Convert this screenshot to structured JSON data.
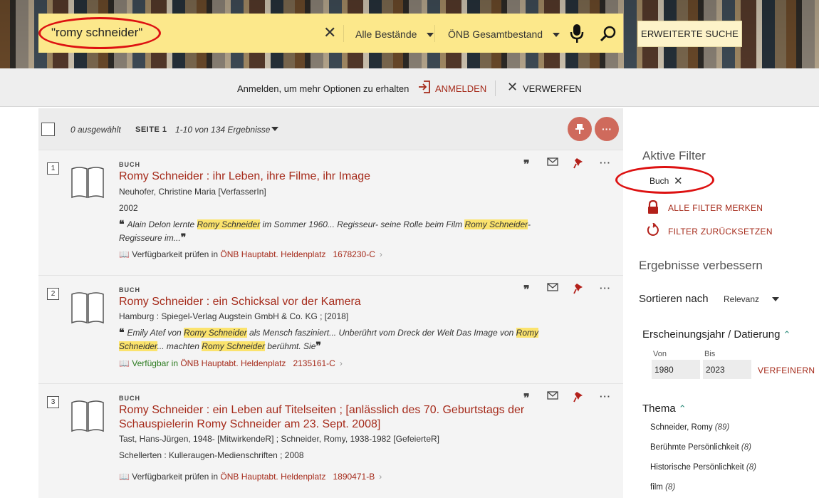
{
  "search": {
    "query": "\"romy schneider\"",
    "scope": "Alle Bestände",
    "collection": "ÖNB Gesamtbestand",
    "advanced_label": "ERWEITERTE SUCHE"
  },
  "login_bar": {
    "text": "Anmelden, um mehr Optionen zu erhalten",
    "login_label": "ANMELDEN",
    "dismiss_label": "VERWERFEN"
  },
  "results_header": {
    "selected": "0 ausgewählt",
    "page": "SEITE 1",
    "count": "1-10 von 134 Ergebnisse"
  },
  "results": [
    {
      "num": "1",
      "type": "BUCH",
      "title": "Romy Schneider : ihr Leben, ihre Filme, ihr Image",
      "author": "Neuhofer, Christine Maria [VerfasserIn]",
      "year": "2002",
      "snippet_parts": [
        "Alain Delon lernte ",
        "Romy Schneider",
        " im Sommer 1960... Regisseur- seine Rolle beim Film ",
        "Romy Schneider",
        "-Regisseure im..."
      ],
      "avail_status": "Verfügbarkeit prüfen in",
      "avail_location": "ÖNB Hauptabt. Heldenplatz",
      "shelfmark": "1678230-C"
    },
    {
      "num": "2",
      "type": "BUCH",
      "title": "Romy Schneider : ein Schicksal vor der Kamera",
      "author": "Hamburg : Spiegel-Verlag Augstein GmbH & Co. KG ; [2018]",
      "snippet_parts": [
        "Emily Atef von ",
        "Romy Schneider",
        " als Mensch fasziniert... Unberührt vom Dreck der Welt Das Image von ",
        "Romy Schneider",
        "... machten ",
        "Romy Schneider",
        " berühmt. Sie"
      ],
      "avail_status": "Verfügbar in",
      "avail_location": "ÖNB Hauptabt. Heldenplatz",
      "shelfmark": "2135161-C"
    },
    {
      "num": "3",
      "type": "BUCH",
      "title": "Romy Schneider : ein Leben auf Titelseiten ; [anlässlich des 70. Geburtstags der Schauspielerin Romy Schneider am 23. Sept. 2008]",
      "author": "Tast, Hans-Jürgen, 1948- [MitwirkendeR] ; Schneider, Romy, 1938-1982 [GefeierteR]",
      "publisher": "Schellerten : Kulleraugen-Medienschriften ; 2008",
      "avail_status": "Verfügbarkeit prüfen in",
      "avail_location": "ÖNB Hauptabt. Heldenplatz",
      "shelfmark": "1890471-B"
    }
  ],
  "sidebar": {
    "active_filters_title": "Aktive Filter",
    "active_filter": "Buch",
    "remember_filters": "ALLE FILTER MERKEN",
    "reset_filters": "FILTER ZURÜCKSETZEN",
    "improve_title": "Ergebnisse verbessern",
    "sort_label": "Sortieren nach",
    "sort_value": "Relevanz",
    "year_facet": "Erscheinungsjahr / Datierung",
    "from_label": "Von",
    "to_label": "Bis",
    "from_value": "1980",
    "to_value": "2023",
    "refine_label": "VERFEINERN",
    "topic_facet": "Thema",
    "topics": [
      {
        "name": "Schneider, Romy",
        "count": "(89)"
      },
      {
        "name": "Berühmte Persönlichkeit",
        "count": "(8)"
      },
      {
        "name": "Historische Persönlichkeit",
        "count": "(8)"
      },
      {
        "name": "film",
        "count": "(8)"
      }
    ]
  },
  "colors": {
    "accent": "#a52a1a",
    "search_bg": "#fce88b",
    "highlight": "#fbe36d",
    "available": "#2a7a1e",
    "annotation": "#dd1111"
  }
}
